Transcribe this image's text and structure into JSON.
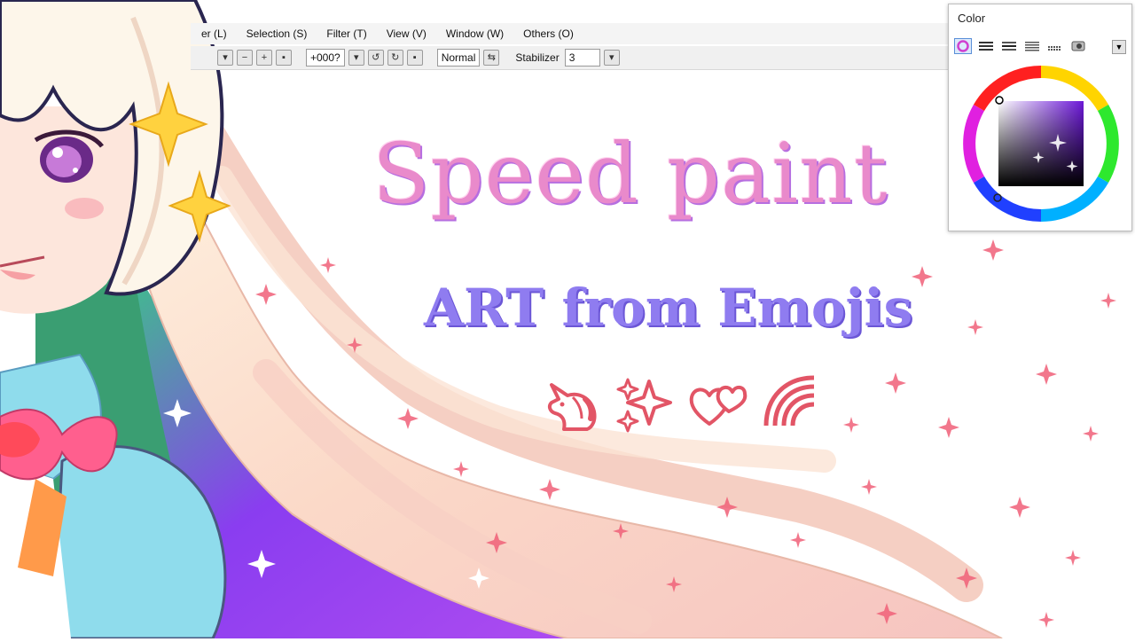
{
  "menu": {
    "items": [
      {
        "label": "er (L)"
      },
      {
        "label": "Selection (S)"
      },
      {
        "label": "Filter (T)"
      },
      {
        "label": "View (V)"
      },
      {
        "label": "Window (W)"
      },
      {
        "label": "Others (O)"
      }
    ]
  },
  "toolbar": {
    "rotation_value": "+000?",
    "blend_mode": "Normal",
    "stabilizer_label": "Stabilizer",
    "stabilizer_value": "3"
  },
  "artwork": {
    "title": "Speed paint",
    "subtitle": "ART from Emojis",
    "emojis": [
      "unicorn-icon",
      "sparkles-icon",
      "two-hearts-icon",
      "rainbow-icon"
    ],
    "colors": {
      "title_pink": "#e98acb",
      "subtitle_purple": "#8f7cf0",
      "emoji_red": "#e25566",
      "hair": "#f8dcc8",
      "hair_purple": "#8a3df0"
    }
  },
  "color_panel": {
    "title": "Color",
    "tabs": [
      "color-wheel-tab",
      "rgb-slider-tab",
      "hsv-slider-tab",
      "swatch-tab",
      "palette-tab",
      "mix-tab"
    ],
    "selected_color": "#6c18d8"
  }
}
